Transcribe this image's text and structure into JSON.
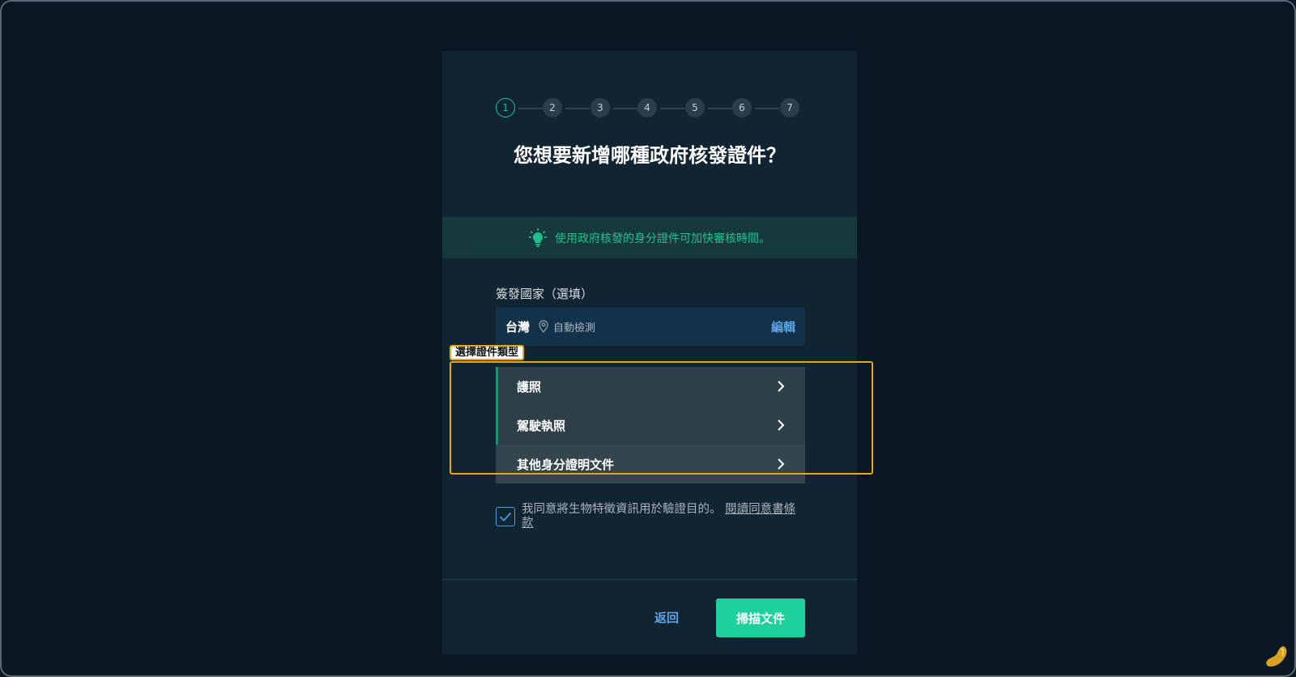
{
  "stepper": {
    "steps": [
      "1",
      "2",
      "3",
      "4",
      "5",
      "6",
      "7"
    ],
    "active_index": 0
  },
  "title": "您想要新增哪種政府核發證件？",
  "tip": {
    "icon": "lightbulb-icon",
    "text": "使用政府核發的身分證件可加快審核時間。"
  },
  "country": {
    "label": "簽發國家（選填）",
    "value": "台灣",
    "autodetect": "自動檢測",
    "edit_label": "編輯"
  },
  "doc_type": {
    "highlight_label": "選擇證件類型",
    "items": [
      "護照",
      "駕駛執照",
      "其他身分證明文件"
    ]
  },
  "consent": {
    "checked": true,
    "text": "我同意將生物特徵資訊用於驗證目的。",
    "link": "閱讀同意書條款"
  },
  "footer": {
    "back_label": "返回",
    "scan_label": "掃描文件"
  },
  "colors": {
    "accent_green": "#1ed19c",
    "link_blue": "#5ba4e8",
    "highlight": "#e6a90f"
  }
}
